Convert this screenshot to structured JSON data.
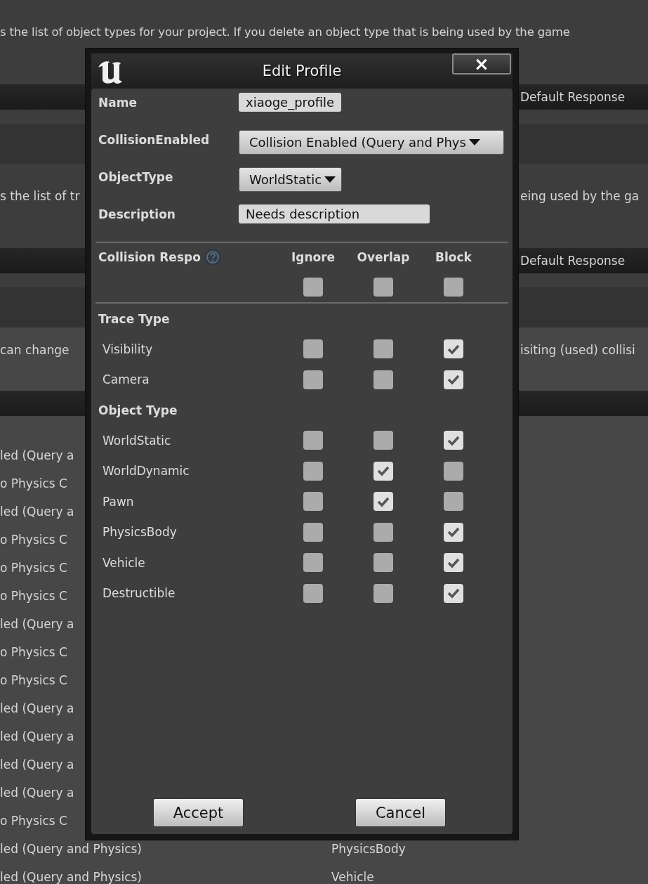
{
  "background": {
    "object_channels_text": "s the list of object types for your project. If you delete an object type that is being used by the game",
    "object_channels_header": "Default Response",
    "trace_channels_text": {
      "left": "s the list of tr",
      "right": "eing used by the ga"
    },
    "trace_channels_header": "Default Response",
    "profiles_text": {
      "left": "can change",
      "right": "isiting (used) collisi"
    },
    "profile_rows": [
      {
        "collision": "led (Query a"
      },
      {
        "collision": "o Physics C"
      },
      {
        "collision": "led (Query a"
      },
      {
        "collision": "o Physics C"
      },
      {
        "collision": "o Physics C"
      },
      {
        "collision": "o Physics C"
      },
      {
        "collision": "led (Query a"
      },
      {
        "collision": "o Physics C"
      },
      {
        "collision": "o Physics C"
      },
      {
        "collision": "led (Query a"
      },
      {
        "collision": "led (Query a"
      },
      {
        "collision": "led (Query a"
      },
      {
        "collision": "led (Query a"
      },
      {
        "collision": "o Physics C"
      },
      {
        "collision": "led (Query and Physics)",
        "object_type": "PhysicsBody"
      },
      {
        "collision": "led (Query and Physics)",
        "object_type": "Vehicle"
      }
    ]
  },
  "dialog": {
    "title": "Edit Profile",
    "close": "×",
    "fields": [
      {
        "label": "Name",
        "kind": "text",
        "value": "xiaoge_profile"
      },
      {
        "label": "CollisionEnabled",
        "kind": "dropdown",
        "value": "Collision Enabled (Query and Phys"
      },
      {
        "label": "ObjectType",
        "kind": "dropdown",
        "value": "WorldStatic"
      },
      {
        "label": "Description",
        "kind": "text",
        "value": "Needs description"
      }
    ],
    "responses": {
      "title": "Collision Respo",
      "columns": [
        "Ignore",
        "Overlap",
        "Block"
      ],
      "all": [
        false,
        false,
        false
      ],
      "groups": [
        {
          "title": "Trace Type",
          "rows": [
            {
              "name": "Visibility",
              "checks": [
                false,
                false,
                true
              ]
            },
            {
              "name": "Camera",
              "checks": [
                false,
                false,
                true
              ]
            }
          ]
        },
        {
          "title": "Object Type",
          "rows": [
            {
              "name": "WorldStatic",
              "checks": [
                false,
                false,
                true
              ]
            },
            {
              "name": "WorldDynamic",
              "checks": [
                false,
                true,
                false
              ]
            },
            {
              "name": "Pawn",
              "checks": [
                false,
                true,
                false
              ]
            },
            {
              "name": "PhysicsBody",
              "checks": [
                false,
                false,
                true
              ]
            },
            {
              "name": "Vehicle",
              "checks": [
                false,
                false,
                true
              ]
            },
            {
              "name": "Destructible",
              "checks": [
                false,
                false,
                true
              ]
            }
          ]
        }
      ]
    },
    "buttons": [
      "Accept",
      "Cancel"
    ]
  }
}
